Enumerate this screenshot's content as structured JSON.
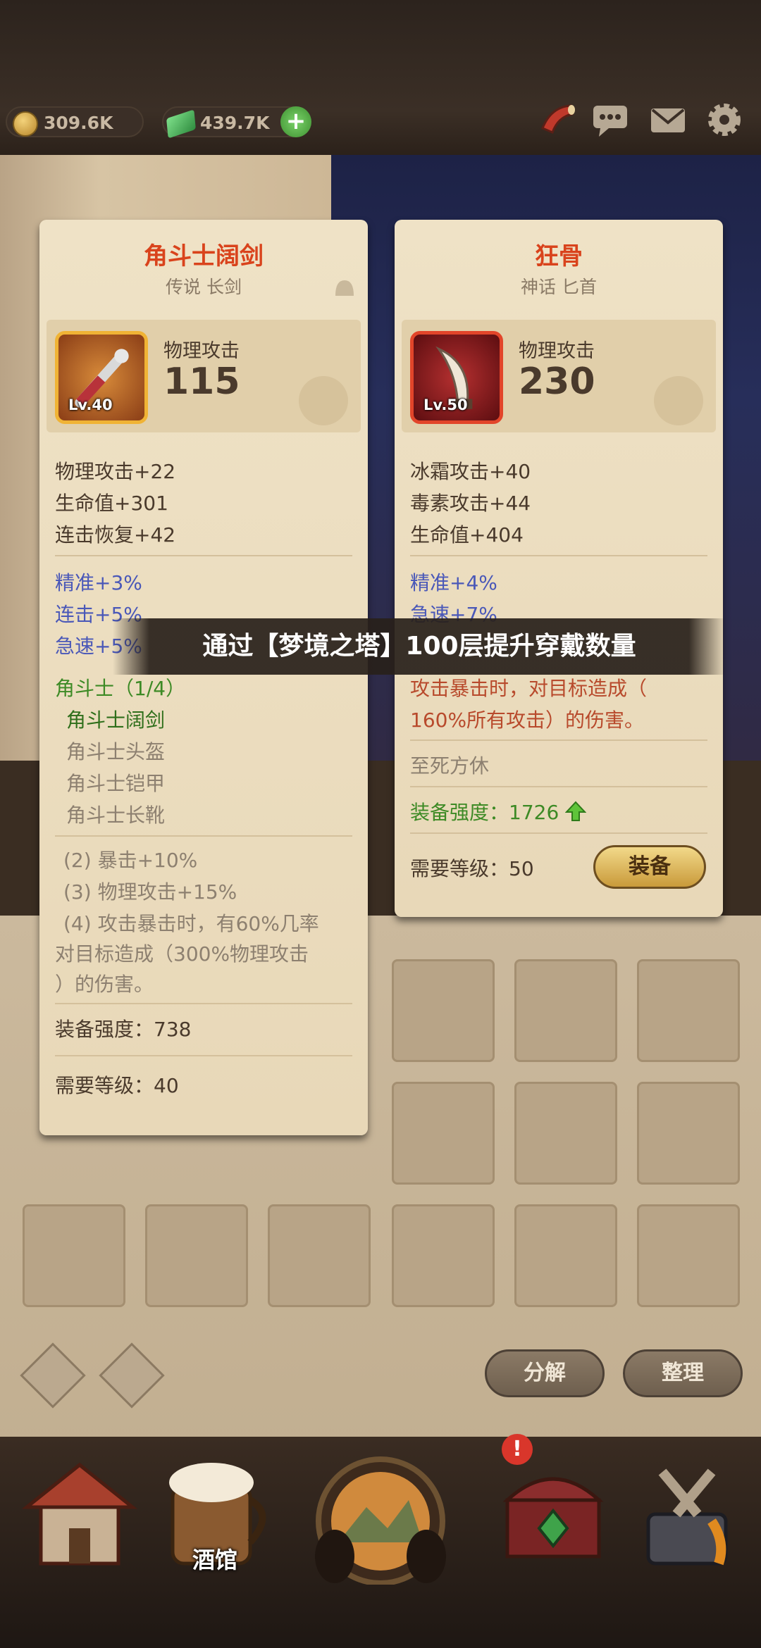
{
  "currency": {
    "gold": "309.6K",
    "gems": "439.7K"
  },
  "popup_banner": "通过【梦境之塔】100层提升穿戴数量",
  "left_card": {
    "name": "角斗士阔剑",
    "subtitle": "传说 长剑",
    "level": "Lv.40",
    "main_stat_label": "物理攻击",
    "main_stat_value": "115",
    "base_stats": [
      "物理攻击+22",
      "生命值+301",
      "连击恢复+42"
    ],
    "bonus_stats": [
      "精准+3%",
      "连击+5%",
      "急速+5%"
    ],
    "set_name": "角斗士（1/4）",
    "set_items": [
      "角斗士阔剑",
      "角斗士头盔",
      "角斗士铠甲",
      "角斗士长靴"
    ],
    "set_bonuses": [
      "(2) 暴击+10%",
      "(3) 物理攻击+15%",
      "(4) 攻击暴击时，有60%几率",
      "对目标造成（300%物理攻击",
      "）的伤害。"
    ],
    "power": "装备强度：738",
    "required_level": "需要等级：40"
  },
  "right_card": {
    "name": "狂骨",
    "subtitle": "神话 匕首",
    "level": "Lv.50",
    "main_stat_label": "物理攻击",
    "main_stat_value": "230",
    "base_stats": [
      "冰霜攻击+40",
      "毒素攻击+44",
      "生命值+404"
    ],
    "bonus_stats": [
      "精准+4%",
      "急速+7%"
    ],
    "effect": [
      "攻击暴击时，对目标造成（",
      "160%所有攻击）的伤害。"
    ],
    "effect_name": "至死方休",
    "power": "装备强度：1726",
    "required_level": "需要等级：50",
    "equip_button": "装备"
  },
  "inventory": {
    "decompose_button": "分解",
    "sort_button": "整理"
  },
  "bottom_nav": {
    "tavern_label": "酒馆"
  },
  "colors": {
    "title_red": "#d9431c",
    "bonus_blue": "#4a58b8",
    "set_green": "#3d8a25"
  }
}
